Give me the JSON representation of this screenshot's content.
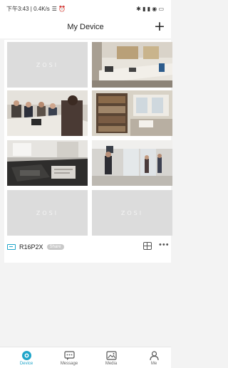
{
  "status_bar": {
    "time": "下午3:43 | 0.4K/s",
    "system_icons": "☰ ⏰",
    "right_icons": "✱ ▮ ▮ ◉ ▭"
  },
  "header": {
    "title": "My Device",
    "add_label": "+"
  },
  "grid": {
    "placeholder_text": "ZOSI",
    "tiles": [
      {
        "type": "placeholder"
      },
      {
        "type": "camera",
        "scene": "office desk"
      },
      {
        "type": "camera",
        "scene": "meeting room"
      },
      {
        "type": "camera",
        "scene": "bookshelf office"
      },
      {
        "type": "camera",
        "scene": "desk with laptop"
      },
      {
        "type": "camera",
        "scene": "lobby"
      },
      {
        "type": "placeholder"
      },
      {
        "type": "placeholder"
      }
    ]
  },
  "device": {
    "name": "R16P2X",
    "badge": "Share",
    "more_label": "•••"
  },
  "tabs": [
    {
      "label": "Device",
      "icon": "device-icon",
      "active": true
    },
    {
      "label": "Message",
      "icon": "message-icon",
      "active": false
    },
    {
      "label": "Media",
      "icon": "media-icon",
      "active": false
    },
    {
      "label": "Me",
      "icon": "person-icon",
      "active": false
    }
  ],
  "colors": {
    "accent": "#1fa5c9",
    "placeholder": "#dcdcdc"
  }
}
